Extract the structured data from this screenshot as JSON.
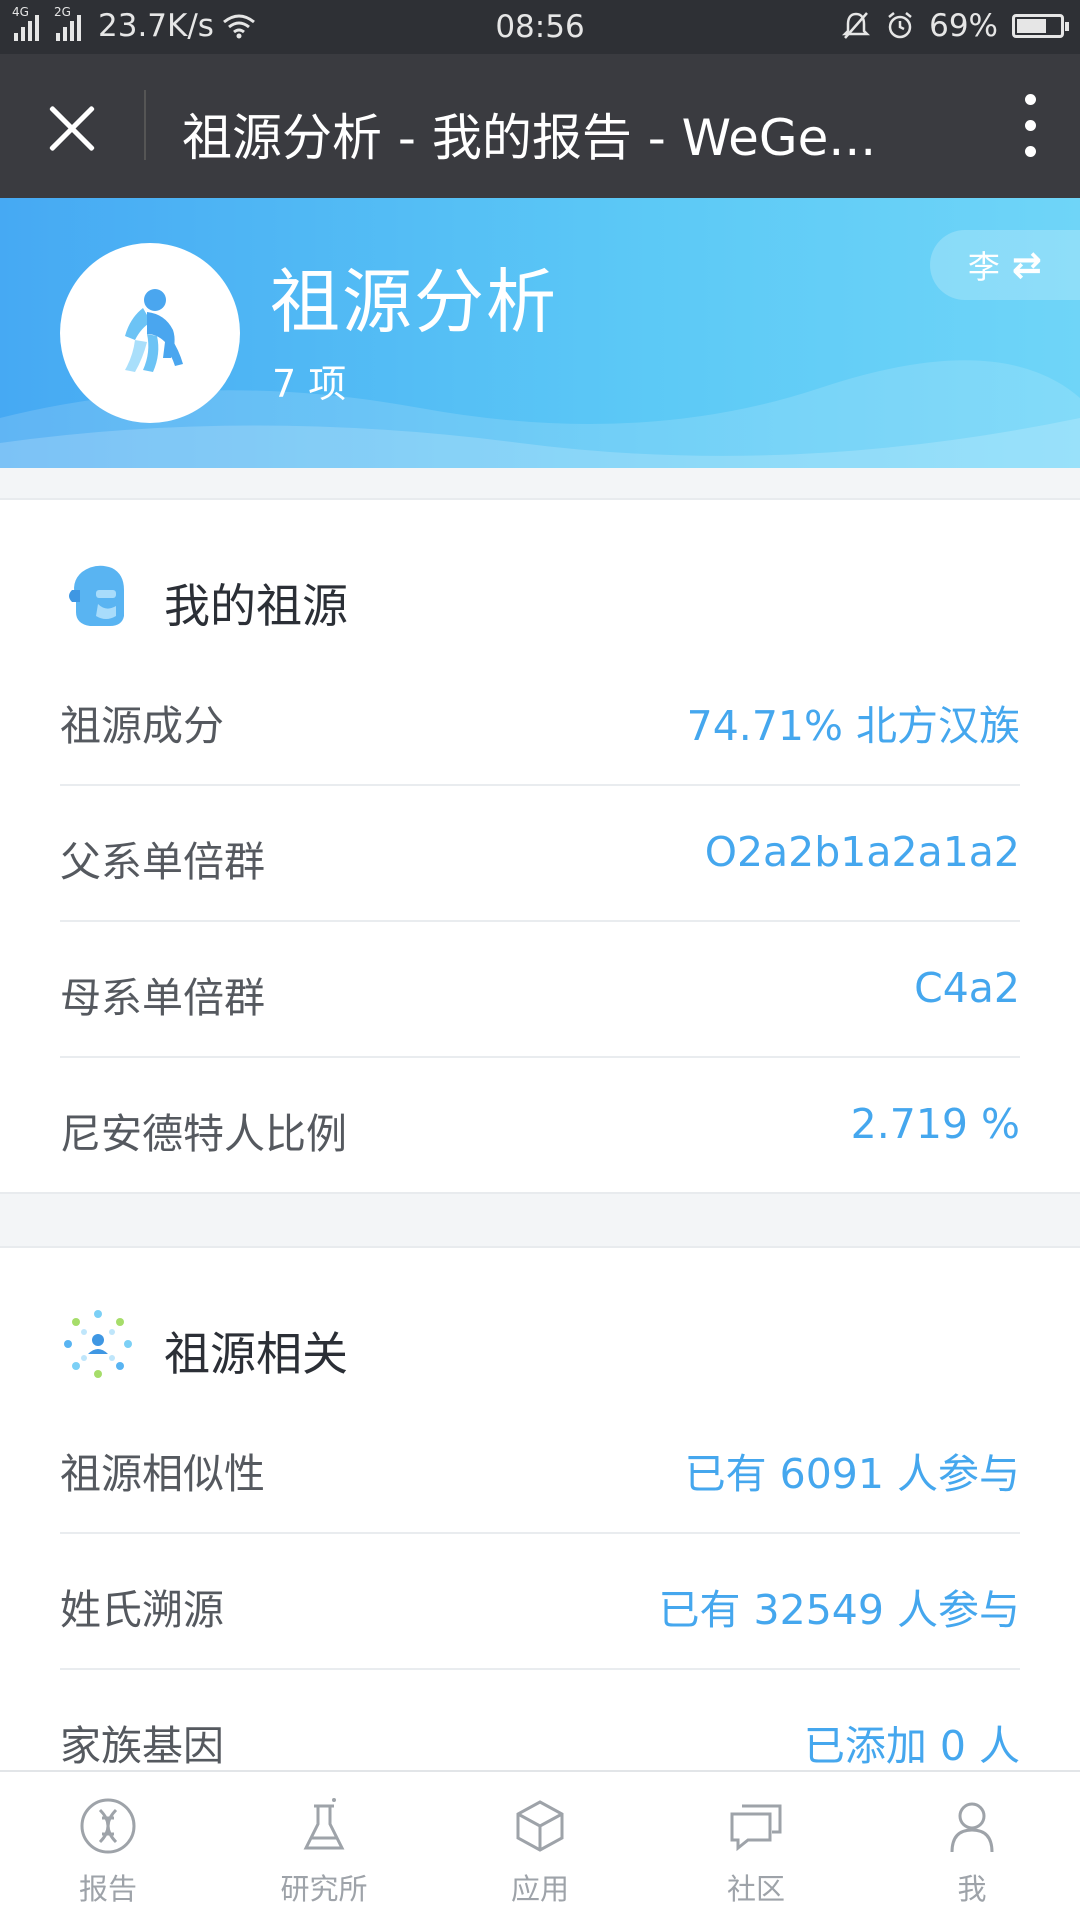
{
  "status_bar": {
    "network_1": "4G",
    "network_2": "2G",
    "speed": "23.7K/s",
    "time": "08:56",
    "battery": "69%",
    "battery_level": 0.69
  },
  "title_bar": {
    "title": "祖源分析 - 我的报告 - WeGe..."
  },
  "header": {
    "title": "祖源分析",
    "count": "7 项",
    "user_initial": "李",
    "switch_icon": "⇄",
    "colors": {
      "gradient_start": "#46a9f3",
      "gradient_end": "#6fd5f8"
    }
  },
  "section_ancestry": {
    "title": "我的祖源",
    "icon": "face-profile-icon",
    "rows": [
      {
        "label": "祖源成分",
        "value": "74.71% 北方汉族"
      },
      {
        "label": "父系单倍群",
        "value": "O2a2b1a2a1a2"
      },
      {
        "label": "母系单倍群",
        "value": "C4a2"
      },
      {
        "label": "尼安德特人比例",
        "value": "2.719 %"
      }
    ]
  },
  "section_related": {
    "title": "祖源相关",
    "icon": "network-people-icon",
    "rows": [
      {
        "label": "祖源相似性",
        "value": "已有 6091 人参与"
      },
      {
        "label": "姓氏溯源",
        "value": "已有 32549 人参与"
      },
      {
        "label": "家族基因",
        "value": "已添加 0 人"
      }
    ]
  },
  "bottom_nav": {
    "items": [
      {
        "label": "报告",
        "icon": "dna-icon"
      },
      {
        "label": "研究所",
        "icon": "flask-icon"
      },
      {
        "label": "应用",
        "icon": "cube-icon"
      },
      {
        "label": "社区",
        "icon": "chat-bubbles-icon"
      },
      {
        "label": "我",
        "icon": "person-icon"
      }
    ]
  },
  "accent_color": "#45a7ee"
}
